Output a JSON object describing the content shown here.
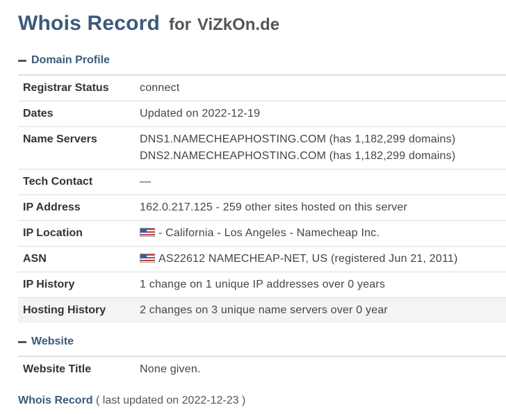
{
  "header": {
    "title_main": "Whois Record",
    "title_for": "for",
    "domain": "ViZkOn.de"
  },
  "domain_profile": {
    "heading": "Domain Profile",
    "rows": [
      {
        "label": "Registrar Status",
        "value": "connect"
      },
      {
        "label": "Dates",
        "value": "Updated on 2022-12-19"
      },
      {
        "label": "Name Servers",
        "value": "DNS1.NAMECHEAPHOSTING.COM (has 1,182,299 domains)",
        "value2": "DNS2.NAMECHEAPHOSTING.COM (has 1,182,299 domains)"
      },
      {
        "label": "Tech Contact",
        "value": "—"
      },
      {
        "label": "IP Address",
        "value": "162.0.217.125 - 259 other sites hosted on this server"
      },
      {
        "label": "IP Location",
        "value": "- California - Los Angeles - Namecheap Inc.",
        "icon": "us-flag-icon"
      },
      {
        "label": "ASN",
        "value": "AS22612 NAMECHEAP-NET, US (registered Jun 21, 2011)",
        "icon": "us-flag-icon"
      },
      {
        "label": "IP History",
        "value": "1 change on 1 unique IP addresses over 0 years"
      },
      {
        "label": "Hosting History",
        "value": "2 changes on 3 unique name servers over 0 year"
      }
    ]
  },
  "website": {
    "heading": "Website",
    "rows": [
      {
        "label": "Website Title",
        "value": "None given."
      }
    ]
  },
  "footer": {
    "link": "Whois Record",
    "note": " ( last updated on 2022-12-23 )"
  },
  "colors": {
    "accent": "#3c5a7a",
    "text": "#333333",
    "border": "#dddddd",
    "shaded_row": "#f4f4f4"
  }
}
